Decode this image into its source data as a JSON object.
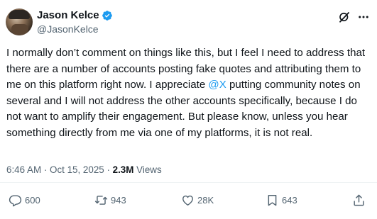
{
  "author": {
    "name": "Jason Kelce",
    "handle": "@JasonKelce",
    "verified": true
  },
  "tweet": {
    "text_part1": "I normally don’t comment on things like this, but I feel I need to address that there are a number of accounts posting fake quotes and attributing them to me on this platform right now.  I appreciate ",
    "mention": "@X",
    "text_part2": " putting community notes on several and I will not address the other accounts specifically, because I do not want to amplify their engagement. But please know, unless you hear something directly from me via one of my platforms, it is not real."
  },
  "meta": {
    "time": "6:46 AM",
    "separator": " · ",
    "date": "Oct 15, 2025",
    "views_count": "2.3M",
    "views_label": "Views"
  },
  "actions": {
    "replies": "600",
    "reposts": "943",
    "likes": "28K",
    "bookmarks": "643"
  },
  "colors": {
    "accent": "#1d9bf0",
    "muted": "#536471",
    "text": "#0f1419"
  },
  "icons": [
    "grok-icon",
    "more-icon",
    "verified-badge-icon",
    "reply-icon",
    "repost-icon",
    "like-icon",
    "bookmark-icon",
    "share-icon"
  ]
}
